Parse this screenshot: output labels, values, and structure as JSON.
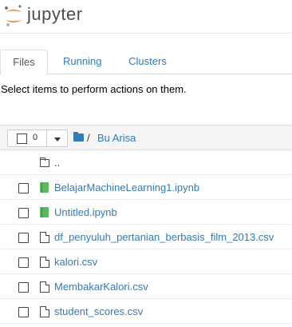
{
  "header": {
    "logo_text": "jupyter",
    "brand_color": "#f37726"
  },
  "tabs": [
    {
      "label": "Files",
      "active": true
    },
    {
      "label": "Running",
      "active": false
    },
    {
      "label": "Clusters",
      "active": false
    }
  ],
  "instructions": "Select items to perform actions on them.",
  "list_header": {
    "selected_count": "0",
    "breadcrumb_separator": "/",
    "current_folder": "Bu Arisa",
    "folder_icon": "folder-icon"
  },
  "items": [
    {
      "name": "..",
      "type": "updir",
      "icon": "folder-icon"
    },
    {
      "name": "BelajarMachineLearning1.ipynb",
      "type": "notebook",
      "icon": "notebook-icon"
    },
    {
      "name": "Untitled.ipynb",
      "type": "notebook",
      "icon": "notebook-icon"
    },
    {
      "name": "df_penyuluh_pertanian_berbasis_film_2013.csv",
      "type": "file",
      "icon": "file-icon"
    },
    {
      "name": "kalori.csv",
      "type": "file",
      "icon": "file-icon"
    },
    {
      "name": "MembakarKalori.csv",
      "type": "file",
      "icon": "file-icon"
    },
    {
      "name": "student_scores.csv",
      "type": "file",
      "icon": "file-icon"
    }
  ]
}
